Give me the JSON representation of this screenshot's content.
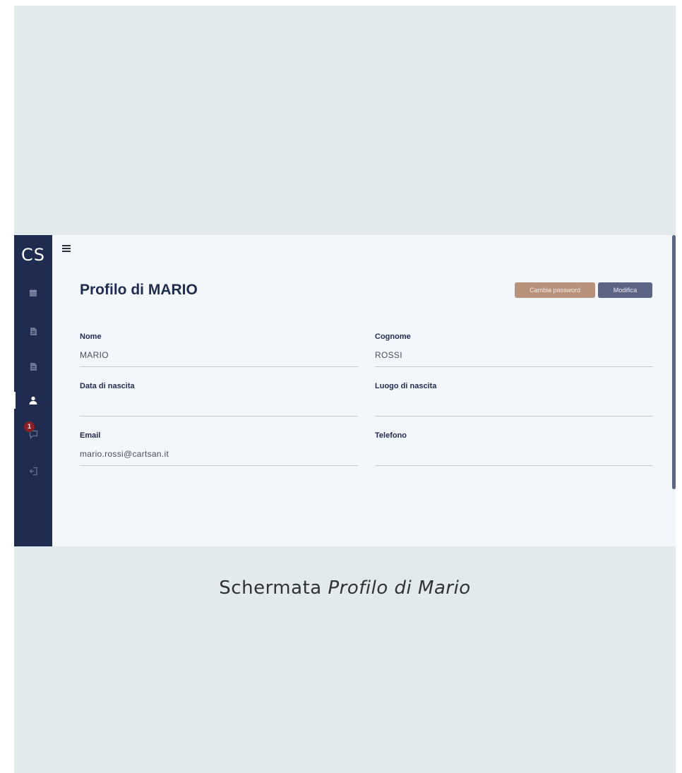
{
  "sidebar": {
    "logo": "CS",
    "notification_count": "1",
    "items": [
      {
        "icon": "calendar-icon"
      },
      {
        "icon": "document-icon"
      },
      {
        "icon": "document-icon"
      },
      {
        "icon": "user-icon",
        "active": true
      },
      {
        "icon": "chat-icon"
      },
      {
        "icon": "logout-icon"
      }
    ]
  },
  "header": {
    "menu_icon": "hamburger-menu-icon"
  },
  "profile": {
    "title": "Profilo di MARIO",
    "buttons": {
      "change_password": "Cambia password",
      "edit": "Modifica"
    },
    "fields": [
      {
        "label": "Nome",
        "value": "MARIO"
      },
      {
        "label": "Cognome",
        "value": "ROSSI"
      },
      {
        "label": "Data di nascita",
        "value": ""
      },
      {
        "label": "Luogo di nascita",
        "value": ""
      },
      {
        "label": "Email",
        "value": "mario.rossi@cartsan.it"
      },
      {
        "label": "Telefono",
        "value": ""
      }
    ]
  },
  "caption": {
    "prefix": "Schermata ",
    "italic": "Profilo di Mario"
  },
  "colors": {
    "sidebar": "#1f2b4f",
    "background": "#f3f6fb",
    "button_password": "#b8917a",
    "button_edit": "#5c6585",
    "badge": "#8e1f22"
  }
}
